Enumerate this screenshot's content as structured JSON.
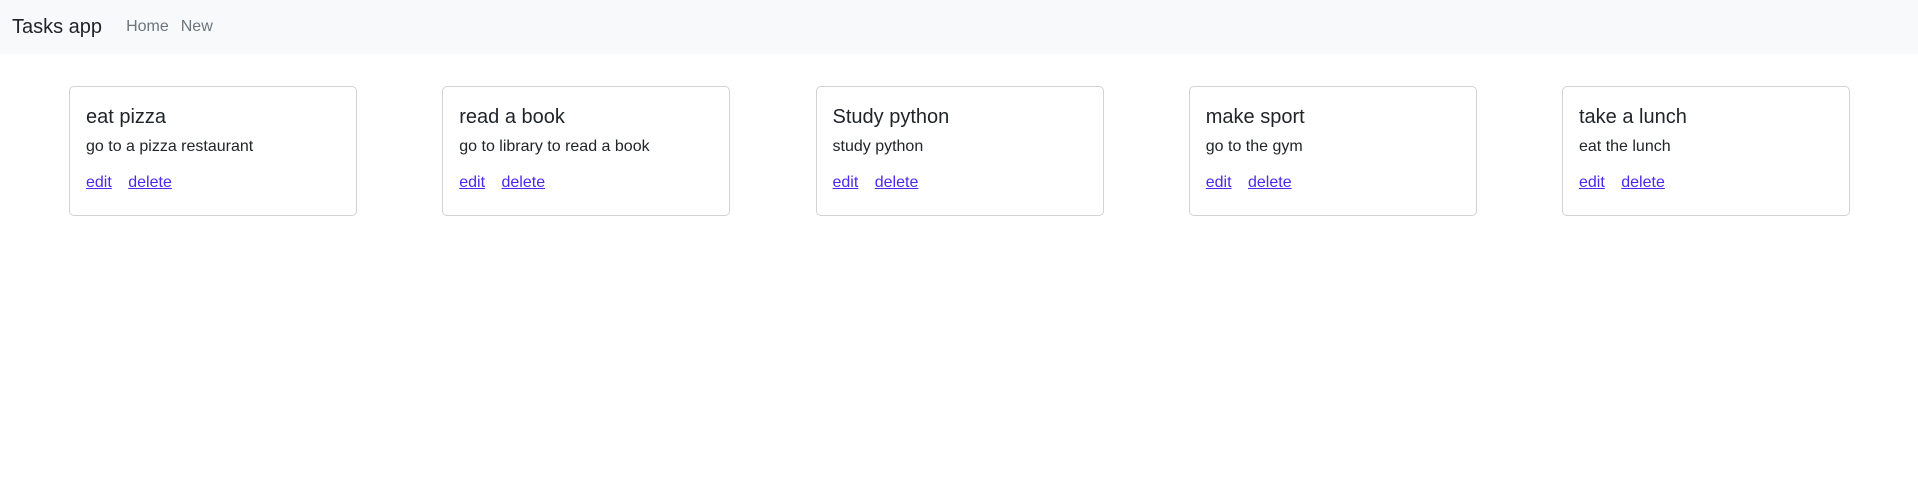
{
  "navbar": {
    "brand": "Tasks app",
    "links": [
      "Home",
      "New"
    ]
  },
  "tasks": [
    {
      "title": "eat pizza",
      "description": "go to a pizza restaurant",
      "edit": "edit",
      "delete": "delete"
    },
    {
      "title": "read a book",
      "description": "go to library to read a book",
      "edit": "edit",
      "delete": "delete"
    },
    {
      "title": "Study python",
      "description": "study python",
      "edit": "edit",
      "delete": "delete"
    },
    {
      "title": "make sport",
      "description": "go to the gym",
      "edit": "edit",
      "delete": "delete"
    },
    {
      "title": "take a lunch",
      "description": "eat the lunch",
      "edit": "edit",
      "delete": "delete"
    }
  ],
  "colors": {
    "navbar_bg": "#f8f9fa",
    "link": "#4b28f0",
    "nav_link": "#6c757d"
  }
}
